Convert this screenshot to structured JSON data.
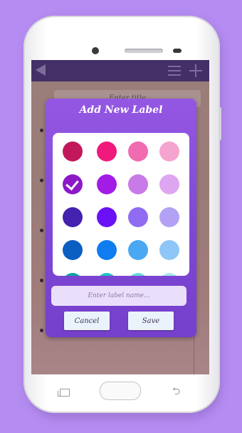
{
  "app": {
    "title_placeholder": "Enter title"
  },
  "toolbar": {
    "back_icon": "back-arrow-icon",
    "menu_icon": "menu-icon",
    "add_icon": "plus-icon"
  },
  "dialog": {
    "title": "Add New Label",
    "input_placeholder": "Enter label name...",
    "cancel_label": "Cancel",
    "save_label": "Save",
    "selected_color": "#8c19c8",
    "colors": [
      [
        "#c2185b",
        "#f0197c",
        "#f06bb0",
        "#f5a3cf"
      ],
      [
        "#8c19c8",
        "#a21ce6",
        "#c77ae8",
        "#dea6f0"
      ],
      [
        "#4521b0",
        "#6a11f5",
        "#8f6cf2",
        "#b3a1f5"
      ],
      [
        "#0b5ec2",
        "#0f7cf0",
        "#4aa8f2",
        "#8ec7f7"
      ],
      [
        "#06a3a3",
        "#20c4c4",
        "#6adada",
        "#a6eaea"
      ]
    ]
  },
  "system_nav": {
    "recent_icon": "recent-apps-icon",
    "home_icon": "home-button-icon",
    "back_icon": "system-back-icon"
  }
}
